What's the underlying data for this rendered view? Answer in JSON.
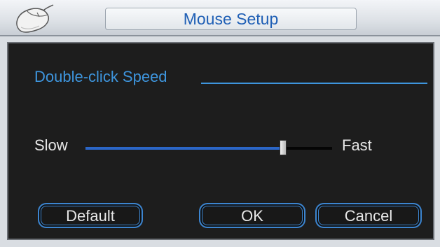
{
  "window": {
    "title": "Mouse Setup",
    "icon": "mouse-icon"
  },
  "settings": {
    "section_label": "Double-click Speed",
    "slider": {
      "min_label": "Slow",
      "max_label": "Fast",
      "value_fraction": 0.8
    }
  },
  "buttons": {
    "default_label": "Default",
    "ok_label": "OK",
    "cancel_label": "Cancel"
  },
  "colors": {
    "accent": "#3e95dd",
    "title_text": "#1f5fb5",
    "panel_bg": "#1d1d1d",
    "slider_fill": "#2b66c7"
  }
}
